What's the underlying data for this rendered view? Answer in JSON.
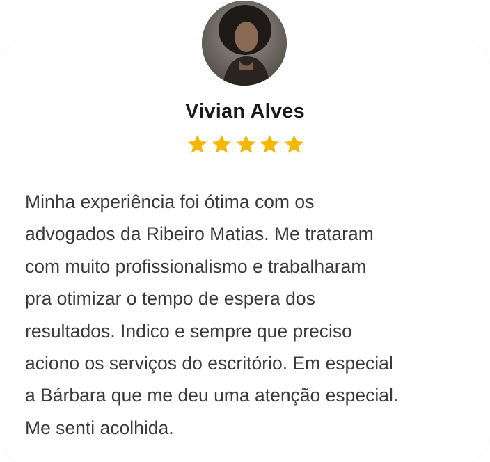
{
  "reviewer": {
    "name": "Vivian Alves",
    "rating": 5,
    "rating_max": 5,
    "avatar_icon": "reviewer-photo"
  },
  "review": {
    "lines": [
      "Minha experiência foi ótima com os",
      "advogados da Ribeiro Matias. Me trataram",
      "com muito profissionalismo e trabalharam",
      "pra otimizar o tempo de espera dos",
      "resultados. Indico e sempre que preciso",
      "aciono os serviços do escritório. Em especial",
      "a Bárbara que me deu uma atenção especial.",
      "Me senti acolhida."
    ]
  },
  "colors": {
    "star": "#f5b800",
    "name": "#1a1a1a",
    "text": "#3a3a3a"
  }
}
